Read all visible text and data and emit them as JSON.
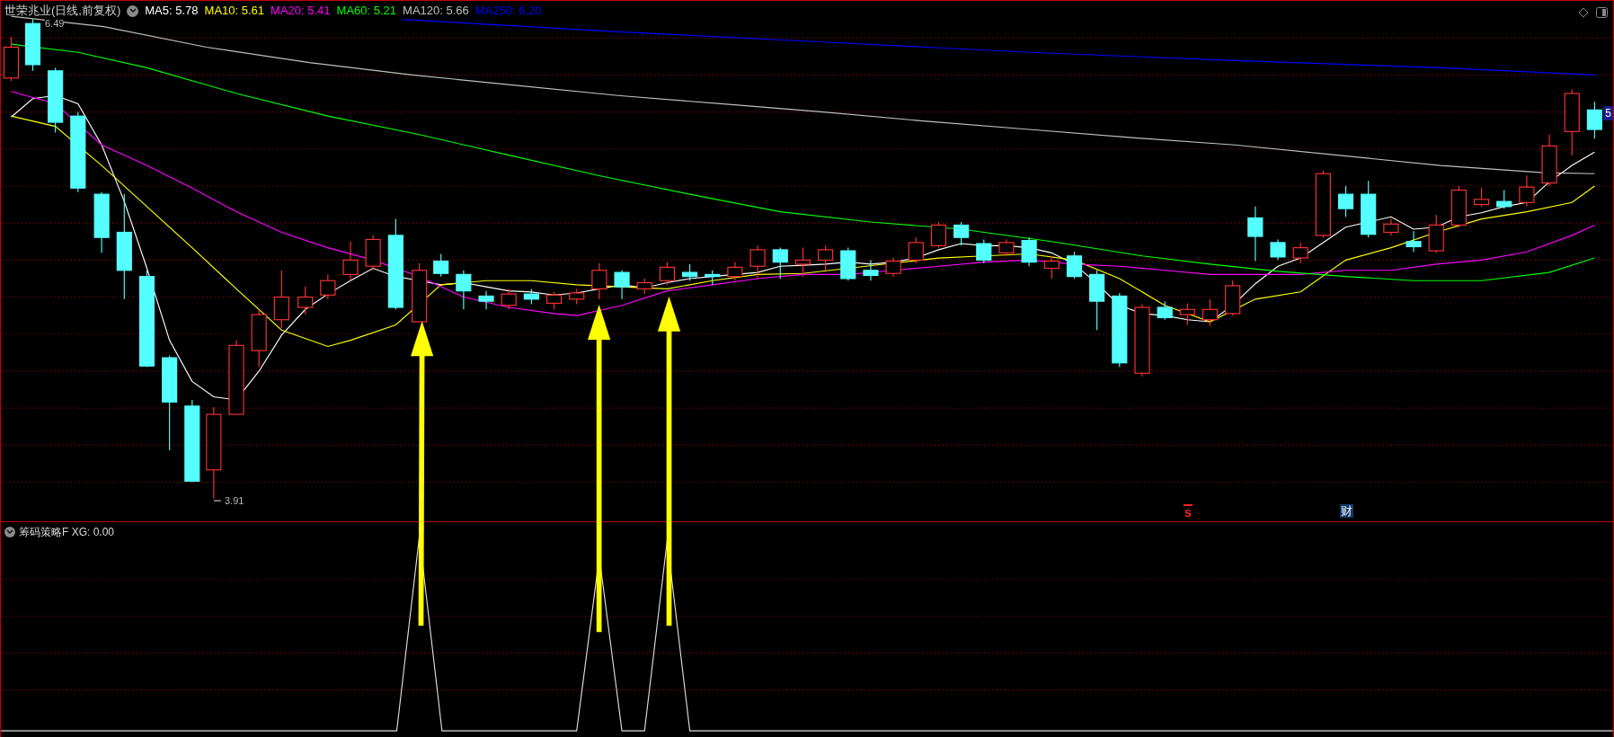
{
  "chart": {
    "title": "世荣兆业(日线,前复权)",
    "ma": [
      {
        "label": "MA5: 5.78",
        "color": "#ffffff"
      },
      {
        "label": "MA10: 5.61",
        "color": "#ffff00"
      },
      {
        "label": "MA20: 5.41",
        "color": "#ff00ff"
      },
      {
        "label": "MA60: 5.21",
        "color": "#00ff00"
      },
      {
        "label": "MA120: 5.66",
        "color": "#c0c0c0"
      },
      {
        "label": "MA250: 6.20",
        "color": "#0000ff"
      }
    ],
    "high_label": "6.49",
    "low_label": "3.91",
    "price_tag": "5",
    "markers": [
      {
        "text": "s",
        "kind": "alert"
      },
      {
        "text": "财",
        "kind": "finance"
      }
    ]
  },
  "indicator": {
    "title": "筹码策略F XG: 0.00"
  }
}
